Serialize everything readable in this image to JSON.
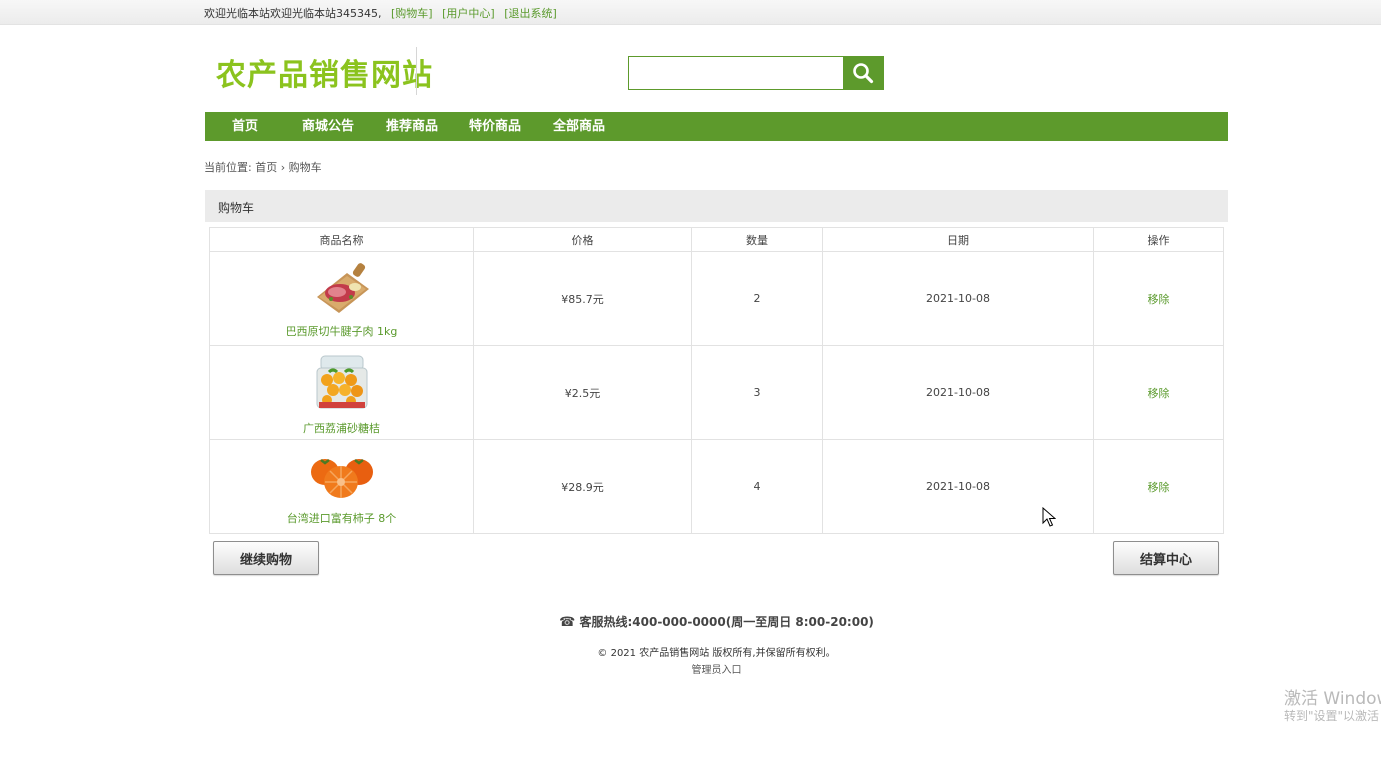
{
  "topbar": {
    "welcome": "欢迎光临本站欢迎光临本站345345,",
    "links": [
      "[购物车]",
      "[用户中心]",
      "[退出系统]"
    ]
  },
  "header": {
    "logo_text": "农产品销售网站",
    "search": {
      "value": "",
      "placeholder": "",
      "icon": "search-icon"
    }
  },
  "nav": {
    "items": [
      "首页",
      "商城公告",
      "推荐商品",
      "特价商品",
      "全部商品"
    ]
  },
  "breadcrumb": {
    "prefix": "当前位置:",
    "home": "首页",
    "separator": "›",
    "current": "购物车"
  },
  "cart": {
    "title": "购物车",
    "columns": [
      "商品名称",
      "价格",
      "数量",
      "日期",
      "操作"
    ],
    "rows": [
      {
        "name": "巴西原切牛腱子肉 1kg",
        "price": "¥85.7元",
        "qty": "2",
        "date": "2021-10-08",
        "action": "移除"
      },
      {
        "name": "广西荔浦砂糖桔",
        "price": "¥2.5元",
        "qty": "3",
        "date": "2021-10-08",
        "action": "移除"
      },
      {
        "name": "台湾进口富有柿子 8个",
        "price": "¥28.9元",
        "qty": "4",
        "date": "2021-10-08",
        "action": "移除"
      }
    ]
  },
  "buttons": {
    "continue": "继续购物",
    "checkout": "结算中心"
  },
  "footer": {
    "hotline": "客服热线:400-000-0000(周一至周日 8:00-20:00)",
    "copyright": "© 2021 农产品销售网站 版权所有,并保留所有权利。",
    "admin": "管理员入口"
  },
  "watermark": {
    "line1": "激活 Windows",
    "line2": "转到\"设置\"以激活 Windows"
  },
  "colors": {
    "accent": "#5d9a2c",
    "logo": "#8bc31e",
    "link": "#5a9a2c"
  }
}
